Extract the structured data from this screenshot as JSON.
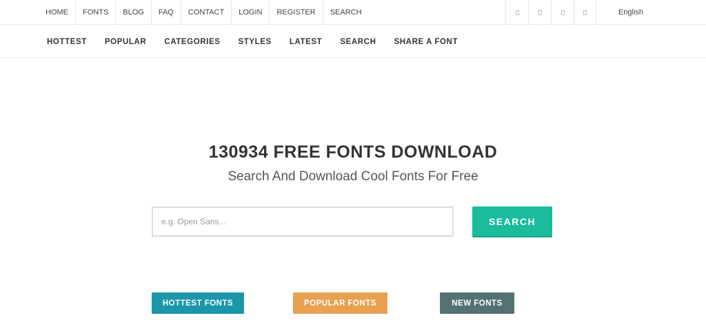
{
  "topnav": {
    "items": [
      "HOME",
      "FONTS",
      "BLOG",
      "FAQ",
      "CONTACT",
      "LOGIN",
      "REGISTER",
      "SEARCH"
    ]
  },
  "social": {
    "icons": [
      "social-icon-1",
      "social-icon-2",
      "social-icon-3",
      "social-icon-4"
    ]
  },
  "language": {
    "label": "English"
  },
  "mainnav": {
    "items": [
      "HOTTEST",
      "POPULAR",
      "CATEGORIES",
      "STYLES",
      "LATEST",
      "SEARCH",
      "SHARE A FONT"
    ]
  },
  "hero": {
    "title": "130934 FREE FONTS DOWNLOAD",
    "subtitle": "Search And Download Cool Fonts For Free"
  },
  "search": {
    "placeholder": "e.g. Open Sans...",
    "value": "",
    "button_label": "SEARCH",
    "button_color": "#1abc9c"
  },
  "category_buttons": [
    {
      "label": "HOTTEST FONTS",
      "color": "#1a97a8"
    },
    {
      "label": "POPULAR FONTS",
      "color": "#e8a14f"
    },
    {
      "label": "NEW FONTS",
      "color": "#547174"
    }
  ]
}
